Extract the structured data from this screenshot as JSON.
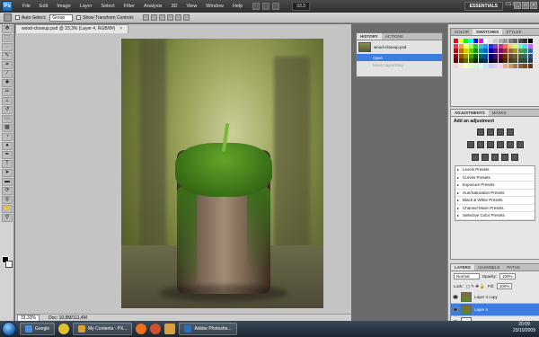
{
  "app": {
    "logo": "Ps",
    "menu": [
      "File",
      "Edit",
      "Image",
      "Layer",
      "Select",
      "Filter",
      "Analysis",
      "3D",
      "View",
      "Window",
      "Help"
    ],
    "zoom": "33.3",
    "workspace": "ESSENTIALS",
    "cs_live": "CS Live"
  },
  "options_bar": {
    "auto_select_label": "Auto-Select:",
    "auto_select_value": "Group",
    "show_transform_label": "Show Transform Controls"
  },
  "document": {
    "tab_title": "wood-closeup.psd @ 33,3% (Layer 4, RGB/8#)",
    "close": "×",
    "zoom_status": "33,33%",
    "doc_info": "Doc: 10,8M/111,4M"
  },
  "history": {
    "tabs": [
      "HISTORY",
      "ACTIONS"
    ],
    "snapshot_label": "wood-closeup.psd",
    "steps": [
      "Open",
      "Move Layer/Step"
    ]
  },
  "swatches": {
    "tabs": [
      "COLOR",
      "SWATCHES",
      "STYLES"
    ],
    "colors": [
      "#ff0000",
      "#ffff00",
      "#00ff00",
      "#00ffff",
      "#0000ff",
      "#ff00ff",
      "#ffffff",
      "#e6e6e6",
      "#cccccc",
      "#b3b3b3",
      "#999999",
      "#808080",
      "#666666",
      "#4d4d4d",
      "#333333",
      "#000000",
      "#ff3333",
      "#ff9933",
      "#ffff66",
      "#99ff66",
      "#33cc33",
      "#33cccc",
      "#3399ff",
      "#3333cc",
      "#9933cc",
      "#cc3399",
      "#ff6666",
      "#ffcc66",
      "#ccff66",
      "#66ffcc",
      "#66ccff",
      "#cc66ff",
      "#cc0000",
      "#cc6600",
      "#cccc00",
      "#66cc00",
      "#009900",
      "#009999",
      "#0066cc",
      "#000099",
      "#660099",
      "#990066",
      "#993333",
      "#996633",
      "#999933",
      "#669933",
      "#339966",
      "#336699",
      "#990000",
      "#994c00",
      "#999900",
      "#4c9900",
      "#006600",
      "#006666",
      "#004c99",
      "#000066",
      "#4c0066",
      "#66004c",
      "#663300",
      "#664d33",
      "#666633",
      "#4d6633",
      "#336666",
      "#334d66",
      "#660000",
      "#663300",
      "#666600",
      "#336600",
      "#003300",
      "#003333",
      "#003366",
      "#000033",
      "#330033",
      "#330022",
      "#4d2600",
      "#4d3b26",
      "#4d4d26",
      "#3b4d26",
      "#264d4d",
      "#263b4d",
      "#ffcccc",
      "#ffe5cc",
      "#ffffcc",
      "#e5ffcc",
      "#ccffcc",
      "#ccffff",
      "#cce5ff",
      "#ccccff",
      "#e5ccff",
      "#ffccf2",
      "#d9b38c",
      "#c69c6d",
      "#a67c52",
      "#8c6239",
      "#754c24",
      "#603913"
    ]
  },
  "adjustments": {
    "tabs": [
      "ADJUSTMENTS",
      "MASKS"
    ],
    "title": "Add an adjustment",
    "presets": [
      "Levels Presets",
      "Curves Presets",
      "Exposure Presets",
      "Hue/Saturation Presets",
      "Black & White Presets",
      "Channel Mixer Presets",
      "Selective Color Presets"
    ]
  },
  "layers": {
    "tabs": [
      "LAYERS",
      "CHANNELS",
      "PATHS"
    ],
    "blend_mode": "Normal",
    "opacity_label": "Opacity:",
    "opacity": "100%",
    "lock_label": "Lock:",
    "fill_label": "Fill:",
    "fill": "100%",
    "items": [
      {
        "name": "Layer 4 copy",
        "selected": false,
        "fx": ""
      },
      {
        "name": "Layer 4",
        "selected": true,
        "fx": ""
      },
      {
        "name": "moss",
        "selected": false,
        "fx": "fx"
      }
    ]
  },
  "taskbar": {
    "items": [
      {
        "label": "Google",
        "color": "#4a8ee0"
      },
      {
        "label": "My Contents - PX...",
        "color": "#e0a030"
      },
      {
        "label": "Adobe Photosho...",
        "color": "#2a6fc0"
      }
    ],
    "time": "20:09",
    "date": "23/10/2009"
  }
}
